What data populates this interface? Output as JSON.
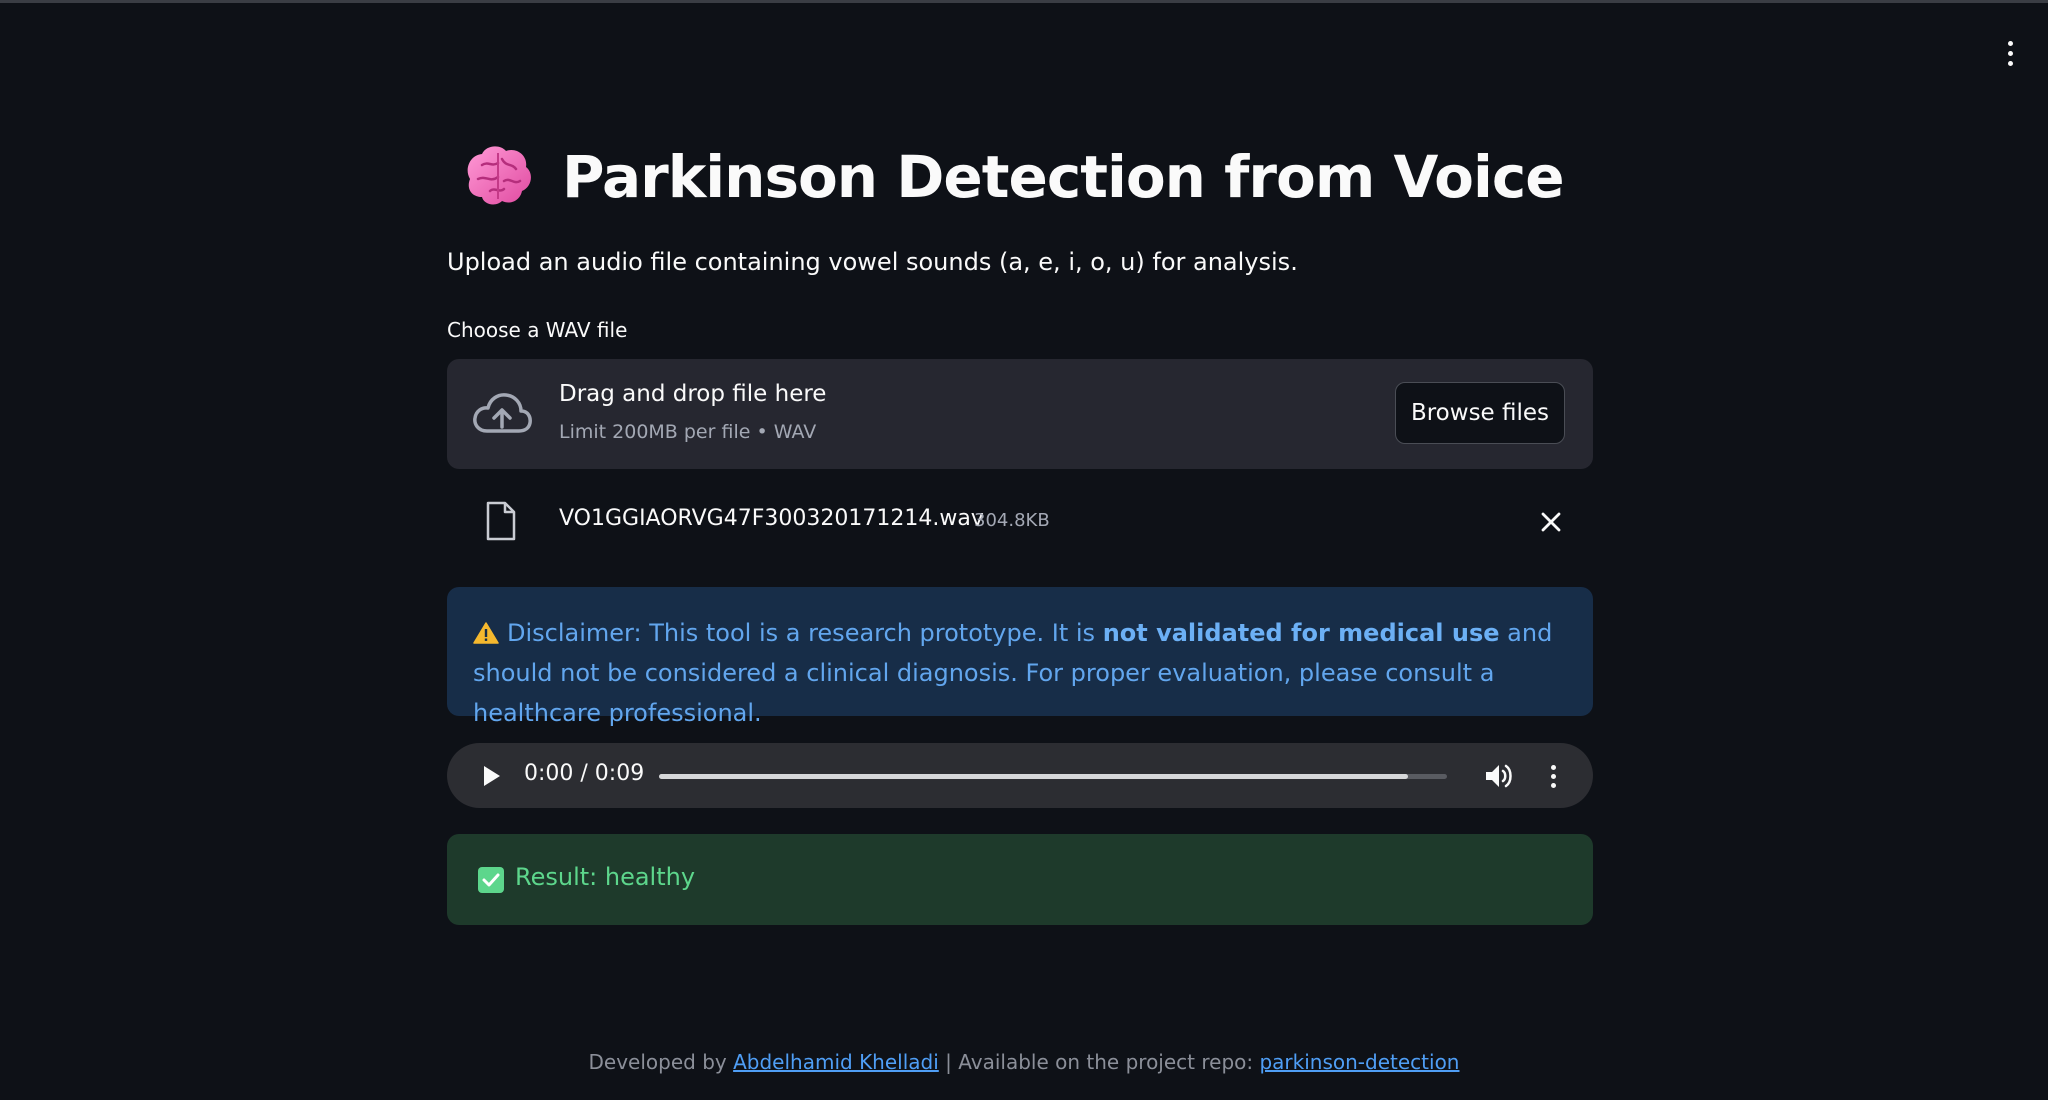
{
  "app": {
    "title": "Parkinson Detection from Voice",
    "title_icon": "brain-icon",
    "subtitle": "Upload an audio file containing vowel sounds (a, e, i, o, u) for analysis."
  },
  "uploader": {
    "label": "Choose a WAV file",
    "drop_text": "Drag and drop file here",
    "limit_text": "Limit 200MB per file • WAV",
    "browse_label": "Browse files",
    "file": {
      "name": "VO1GGIAORVG47F300320171214.wav",
      "size": "304.8KB"
    }
  },
  "disclaimer": {
    "prefix": "Disclaimer: This tool is a research prototype. It is ",
    "emphasis": "not validated for medical use",
    "suffix": " and should not be considered a clinical diagnosis. For proper evaluation, please consult a healthcare professional."
  },
  "audio_player": {
    "time": "0:00 / 0:09",
    "progress_fraction": 0.95
  },
  "result": {
    "text": "Result: healthy"
  },
  "footer": {
    "prefix": "Developed by ",
    "author_link": "Abdelhamid Khelladi",
    "middle": " | Available on the project repo: ",
    "repo_link": "parkinson-detection"
  },
  "colors": {
    "background": "#0e1117",
    "info_bg": "#172d48",
    "info_text": "#62a6ee",
    "success_bg": "#1e3a2b",
    "success_text": "#5dd68c",
    "link": "#4f9ef5"
  }
}
